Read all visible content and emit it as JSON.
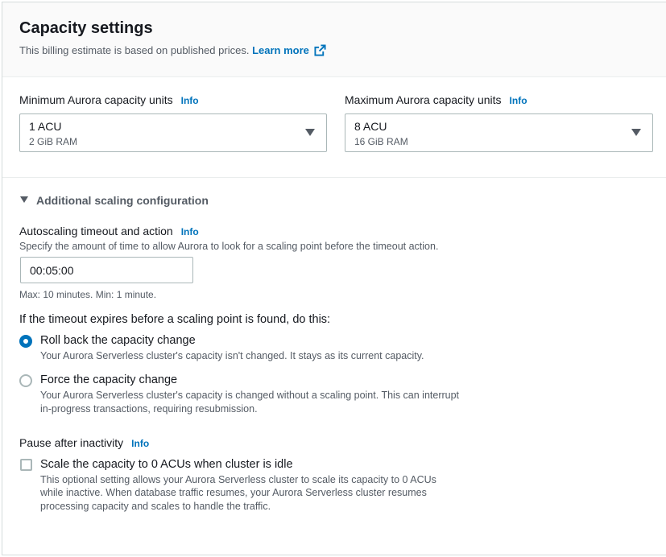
{
  "header": {
    "title": "Capacity settings",
    "subtitle": "This billing estimate is based on published prices.",
    "learn_more": "Learn more",
    "external_icon": "external-link-icon"
  },
  "min_acu": {
    "label": "Minimum Aurora capacity units",
    "info": "Info",
    "value": "1 ACU",
    "sub": "2 GiB RAM"
  },
  "max_acu": {
    "label": "Maximum Aurora capacity units",
    "info": "Info",
    "value": "8 ACU",
    "sub": "16 GiB RAM"
  },
  "additional": {
    "title": "Additional scaling configuration",
    "icon": "caret-down-icon"
  },
  "autoscaling": {
    "label": "Autoscaling timeout and action",
    "info": "Info",
    "description": "Specify the amount of time to allow Aurora to look for a scaling point before the timeout action.",
    "value": "00:05:00",
    "constraint": "Max: 10 minutes. Min: 1 minute."
  },
  "timeout_action": {
    "label": "If the timeout expires before a scaling point is found, do this:",
    "options": [
      {
        "label": "Roll back the capacity change",
        "description": "Your Aurora Serverless cluster's capacity isn't changed. It stays as its current capacity.",
        "checked": true
      },
      {
        "label": "Force the capacity change",
        "description_line1": "Your Aurora Serverless cluster's capacity is changed without a scaling point. This can interrupt",
        "description_line2": "in-progress transactions, requiring resubmission.",
        "checked": false
      }
    ]
  },
  "pause": {
    "label": "Pause after inactivity",
    "info": "Info",
    "checkbox_label": "Scale the capacity to 0 ACUs when cluster is idle",
    "description_line1": "This optional setting allows your Aurora Serverless cluster to scale its capacity to 0 ACUs",
    "description_line2": "while inactive. When database traffic resumes, your Aurora Serverless cluster resumes",
    "description_line3": "processing capacity and scales to handle the traffic.",
    "checked": false
  },
  "colors": {
    "accent": "#0073bb",
    "text": "#16191f",
    "muted": "#545b64",
    "border": "#aab7b8"
  }
}
